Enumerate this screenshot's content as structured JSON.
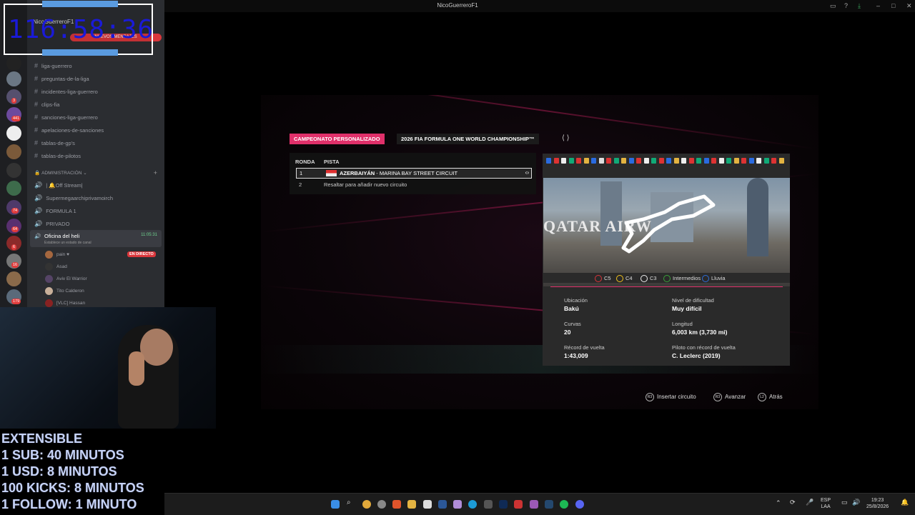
{
  "window": {
    "title": "NicoGuerreroF1"
  },
  "timer": {
    "value": "116:58:36",
    "header_user": "NicoGuerreroF1",
    "header_badge": "NUEVOS MENSAJES"
  },
  "discord": {
    "server_badges": [
      "3",
      "441",
      "74",
      "64",
      "6",
      "16",
      "179"
    ],
    "channels": [
      "liga-guerrero",
      "preguntas-de-la-liga",
      "incidentes-liga-guerrero",
      "clips-fia",
      "sanciones-liga-guerrero",
      "apelaciones-de-sanciones",
      "tablas-de-gp's",
      "tablas-de-pilotos"
    ],
    "category": "ADMINISTRACIÓN",
    "voice_channels": [
      "| 🔔Off Stream|",
      "Supermegaarchiprivamoirch",
      "FORMULA 1",
      "PRIVADO"
    ],
    "active_voice": {
      "name": "Oficina del heli",
      "time": "11:05:31",
      "status": "Establece un estado de canal"
    },
    "users": [
      {
        "name": "pain ♥",
        "badge": "EN DIRECTO"
      },
      {
        "name": "Asad"
      },
      {
        "name": "Aviv El Warrior"
      },
      {
        "name": "Tito Calderon"
      },
      {
        "name": "[VLC] Hassan"
      }
    ]
  },
  "stream_overlay": {
    "lines": [
      "EXTENSIBLE",
      "1 SUB: 40 MINUTOS",
      "1 USD: 8 MINUTOS",
      "100 KICKS: 8 MINUTOS",
      "1 FOLLOW: 1 MINUTO"
    ]
  },
  "game": {
    "tab_active": "CAMPEONATO PERSONALIZADO",
    "tab_title": "2026 FIA FORMULA ONE WORLD CHAMPIONSHIP™",
    "table_headers": {
      "round": "RONDA",
      "track": "PISTA"
    },
    "rows": [
      {
        "round": "1",
        "country": "AZERBAIYÁN",
        "circuit": " - MARINA BAY STREET CIRCUIT"
      },
      {
        "round": "2",
        "text": "Resaltar para añadir nuevo circuito"
      }
    ],
    "track_sign": "QATAR AIRW",
    "tyres": [
      {
        "code": "C5",
        "color": "#d8363a"
      },
      {
        "code": "C4",
        "color": "#f2c21c"
      },
      {
        "code": "C3",
        "color": "#eeeeee"
      },
      {
        "code": "Intermedios",
        "color": "#3aa23a"
      },
      {
        "code": "Lluvia",
        "color": "#2f6ed9"
      }
    ],
    "info": {
      "location_label": "Ubicación",
      "location": "Bakú",
      "difficulty_label": "Nivel de dificultad",
      "difficulty": "Muy difícil",
      "turns_label": "Curvas",
      "turns": "20",
      "length_label": "Longitud",
      "length": "6,003 km (3,730 mi)",
      "record_label": "Récord de vuelta",
      "record": "1:43,009",
      "record_driver_label": "Piloto con récord de vuelta",
      "record_driver": "C. Leclerc (2019)"
    },
    "hints": [
      {
        "btn": "R3",
        "label": "Insertar circuito"
      },
      {
        "btn": "R3",
        "label": "Avanzar"
      },
      {
        "btn": "L2",
        "label": "Atrás"
      }
    ]
  },
  "taskbar": {
    "lang": "ESP",
    "layout": "LAA",
    "time": "19:23",
    "date": "25/8/2026"
  }
}
